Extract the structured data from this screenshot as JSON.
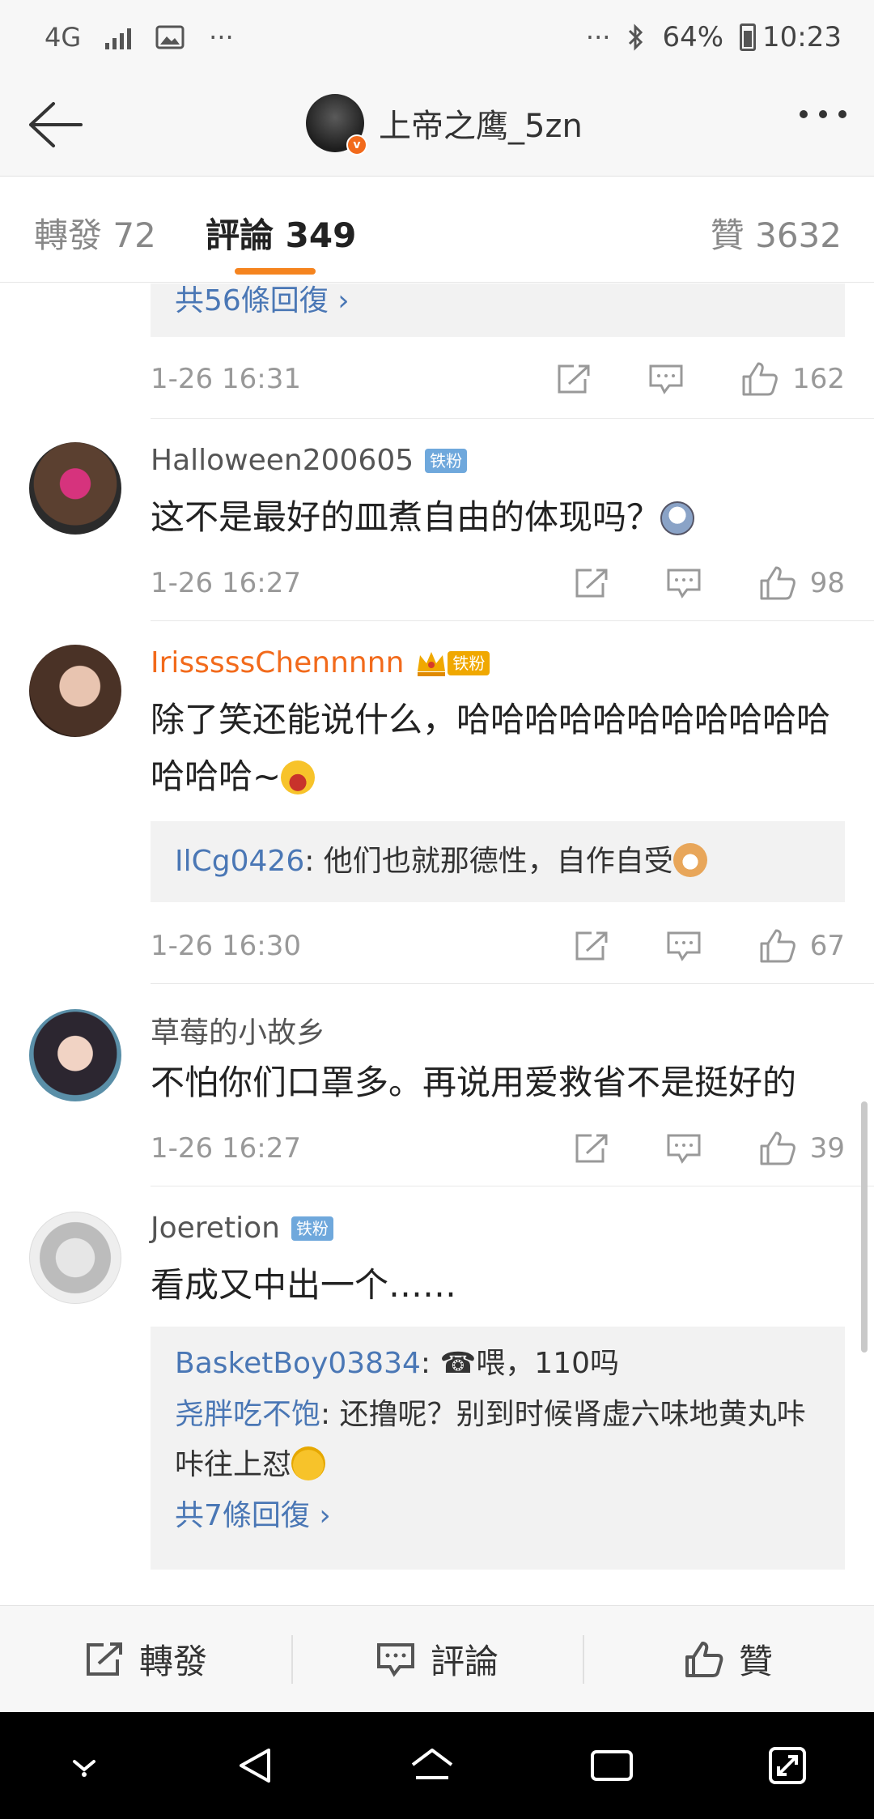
{
  "status_bar": {
    "network": "4G",
    "dots": "···",
    "dots_right": "···",
    "battery": "64%",
    "time": "10:23"
  },
  "header": {
    "title": "上帝之鹰_5zn",
    "verified_mark": "v"
  },
  "tabs": {
    "repost": "轉發 72",
    "comment": "評論 349",
    "like": "贊 3632"
  },
  "comments": [
    {
      "partial": true,
      "replies_more": "共56條回復 ›",
      "time": "1-26 16:31",
      "likes": "162"
    },
    {
      "name": "Halloween200605",
      "badge": "铁粉",
      "text": "这不是最好的皿煮自由的体现吗？",
      "time": "1-26 16:27",
      "likes": "98"
    },
    {
      "name": "IrisssssChennnnn",
      "badge": "铁粉",
      "text": "除了笑还能说什么，哈哈哈哈哈哈哈哈哈哈哈哈哈哈~",
      "reply_user": "IlCg0426",
      "reply_text": ": 他们也就那德性，自作自受",
      "time": "1-26 16:30",
      "likes": "67"
    },
    {
      "name": "草莓的小故乡",
      "text": "不怕你们口罩多。再说用爱救省不是挺好的",
      "time": "1-26 16:27",
      "likes": "39"
    },
    {
      "name": "Joeretion",
      "badge": "铁粉",
      "text": "看成又中出一个……",
      "reply1_user": "BasketBoy03834",
      "reply1_text": ": ☎喂，110吗",
      "reply2_user": "尧胖吃不饱",
      "reply2_text": ": 还撸呢？别到时候肾虚六味地黄丸咔咔往上怼",
      "replies_more": "共7條回復 ›"
    }
  ],
  "bottom_bar": {
    "repost": "轉發",
    "comment": "評論",
    "like": "贊"
  },
  "colors": {
    "accent": "#f5841f",
    "link": "#4a77b5",
    "vip_name": "#f26a1b"
  }
}
